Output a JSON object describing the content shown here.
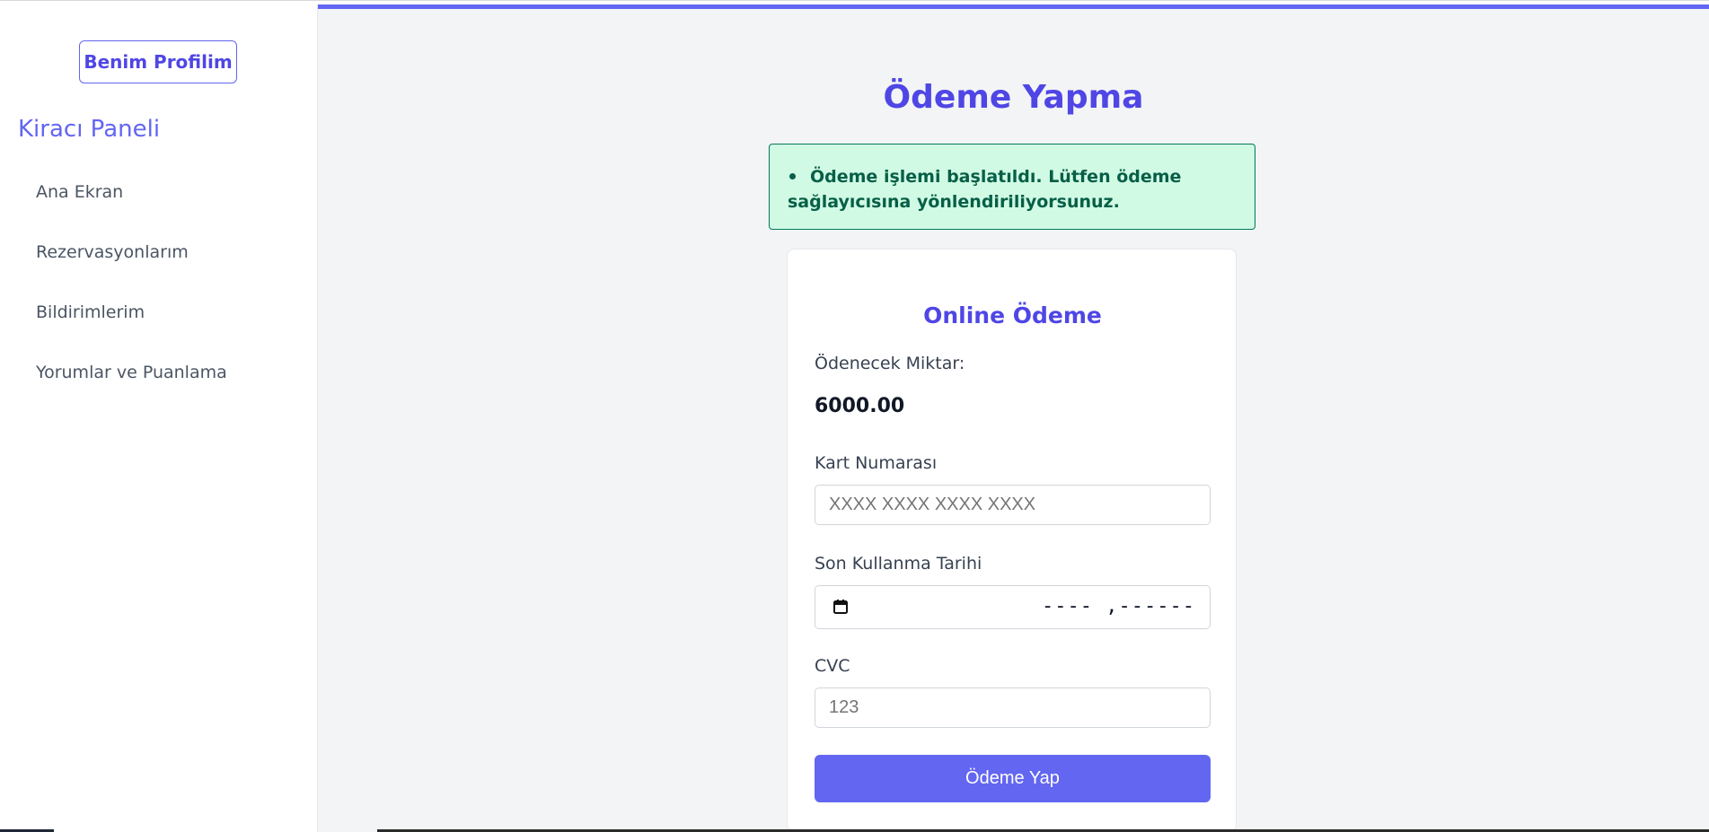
{
  "sidebar": {
    "profile_button": "Benim Profilim",
    "title": "Kiracı Paneli",
    "items": [
      {
        "label": "Ana Ekran"
      },
      {
        "label": "Rezervasyonlarım"
      },
      {
        "label": "Bildirimlerim"
      },
      {
        "label": "Yorumlar ve Puanlama"
      }
    ]
  },
  "main": {
    "title": "Ödeme Yapma",
    "alert": "Ödeme işlemi başlatıldı. Lütfen ödeme sağlayıcısına yönlendiriliyorsunuz.",
    "card": {
      "title": "Online Ödeme",
      "amount_label": "Ödenecek Miktar:",
      "amount_value": "6000.00",
      "card_number_label": "Kart Numarası",
      "card_number_placeholder": "XXXX XXXX XXXX XXXX",
      "expiry_label": "Son Kullanma Tarihi",
      "expiry_placeholder": "---- ,------",
      "cvc_label": "CVC",
      "cvc_placeholder": "123",
      "submit_label": "Ödeme Yap"
    }
  },
  "colors": {
    "accent": "#6366f1",
    "accent_dark": "#4f46e5",
    "alert_bg": "#d1fae5",
    "alert_text": "#065f46",
    "main_bg": "#f3f4f6"
  },
  "icons": {
    "calendar": "calendar-icon"
  }
}
